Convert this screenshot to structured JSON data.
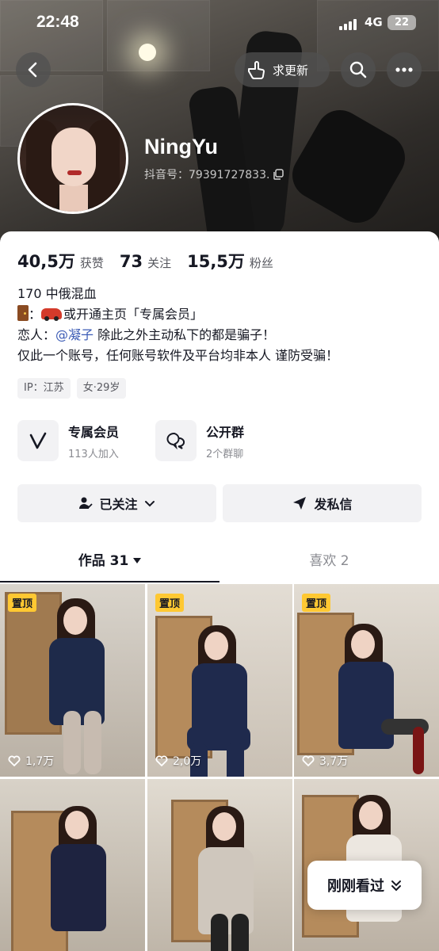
{
  "status_bar": {
    "time": "22:48",
    "network": "4G",
    "battery": "22"
  },
  "top_actions": {
    "request_update_label": "求更新"
  },
  "profile": {
    "name": "NingYu",
    "id_text": "抖音号：79391727833.",
    "stats": [
      {
        "value": "40,5万",
        "label": "获赞"
      },
      {
        "value": "73",
        "label": "关注"
      },
      {
        "value": "15,5万",
        "label": "粉丝"
      }
    ],
    "bio": {
      "line1": "170 中俄混血",
      "line2_sep": "：",
      "line2_text": "或开通主页「专属会员」",
      "line3_prefix": "恋人：",
      "line3_mention": "@凝子",
      "line3_suffix": " 除此之外主动私下的都是骗子！",
      "line4": "仅此一个账号，任何账号软件及平台均非本人 谨防受骗！"
    },
    "tags": [
      "IP：江苏",
      "女·29岁"
    ]
  },
  "features": [
    {
      "title": "专属会员",
      "subtitle": "113人加入",
      "icon": "v-logo-icon"
    },
    {
      "title": "公开群",
      "subtitle": "2个群聊",
      "icon": "chat-bubbles-icon"
    }
  ],
  "actions": {
    "following_label": "已关注",
    "message_label": "发私信"
  },
  "tabs": {
    "works_label": "作品 31",
    "likes_label": "喜欢 2"
  },
  "grid": {
    "pinned_label": "置顶",
    "items": [
      {
        "likes": "1,7万",
        "pinned": true
      },
      {
        "likes": "2,0万",
        "pinned": true
      },
      {
        "likes": "3,7万",
        "pinned": true
      },
      {
        "likes": "",
        "pinned": false
      },
      {
        "likes": "",
        "pinned": false
      },
      {
        "likes": "",
        "pinned": false
      }
    ]
  },
  "floating": {
    "recent_label": "刚刚看过"
  },
  "colors": {
    "accent_mention": "#3b5bb5",
    "pin_badge": "#ffc832",
    "text_primary": "#161823"
  }
}
